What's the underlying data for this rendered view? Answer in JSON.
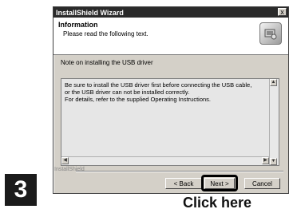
{
  "window": {
    "title": "InstallShield Wizard",
    "close_label": "x"
  },
  "header": {
    "title": "Information",
    "subtitle": "Please read the following text."
  },
  "note": "Note on installing the USB driver",
  "body_text": "Be sure to install the USB driver first before connecting the USB cable,\nor the USB driver can not be installed correctly.\nFor details, refer to the supplied Operating Instructions.",
  "footer": {
    "brand": "InstallShield"
  },
  "buttons": {
    "back": "< Back",
    "next": "Next >",
    "cancel": "Cancel"
  },
  "annotation": {
    "step": "3",
    "caption": "Click here"
  },
  "icons": {
    "installer": "installer-icon",
    "close": "close-icon"
  }
}
